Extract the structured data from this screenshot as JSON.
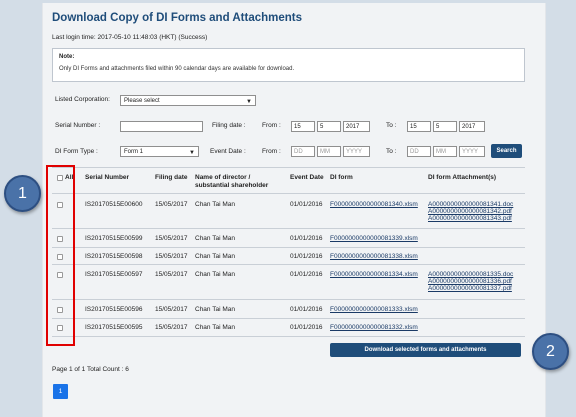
{
  "page": {
    "title": "Download Copy of DI Forms and Attachments",
    "last_login": "Last login time: 2017-05-10 11:48:03 (HKT) (Success)",
    "note_title": "Note:",
    "note_text": "Only DI Forms and attachments filed within 90 calendar days are available for download."
  },
  "filters": {
    "listed_corp_label": "Listed Corporation:",
    "listed_corp_value": "Please select",
    "serial_label": "Serial Number :",
    "serial_value": "",
    "filing_date_label": "Filing date :",
    "from_label": "From :",
    "to_label": "To :",
    "filing_from": {
      "day": "15",
      "month": "5",
      "year": "2017"
    },
    "filing_to": {
      "day": "15",
      "month": "5",
      "year": "2017"
    },
    "form_type_label": "DI Form Type :",
    "form_type_value": "Form 1",
    "event_date_label": "Event Date :",
    "event_from": {
      "day": "DD",
      "month": "MM",
      "year": "YYYY"
    },
    "event_to": {
      "day": "DD",
      "month": "MM",
      "year": "YYYY"
    },
    "search_label": "Search"
  },
  "table": {
    "headers": {
      "all": "All",
      "serial": "Serial Number",
      "filing_date": "Filing date",
      "name": "Name of director / substantial shareholder",
      "event_date": "Event Date",
      "di_form": "DI form",
      "attachments": "DI form Attachment(s)"
    },
    "rows": [
      {
        "serial": "IS20170515E00600",
        "filing": "15/05/2017",
        "name": "Chan Tai Man",
        "event": "01/01/2016",
        "form": "F0000000000000081340.xlsm",
        "attachments": [
          "A0000000000000081341.doc",
          "A0000000000000081342.pdf",
          "A0000000000000081343.pdf"
        ]
      },
      {
        "serial": "IS20170515E00599",
        "filing": "15/05/2017",
        "name": "Chan Tai Man",
        "event": "01/01/2016",
        "form": "F0000000000000081339.xlsm",
        "attachments": []
      },
      {
        "serial": "IS20170515E00598",
        "filing": "15/05/2017",
        "name": "Chan Tai Man",
        "event": "01/01/2016",
        "form": "F0000000000000081338.xlsm",
        "attachments": []
      },
      {
        "serial": "IS20170515E00597",
        "filing": "15/05/2017",
        "name": "Chan Tai Man",
        "event": "01/01/2016",
        "form": "F0000000000000081334.xlsm",
        "attachments": [
          "A0000000000000081335.doc",
          "A0000000000000081336.pdf",
          "A0000000000000081337.pdf"
        ]
      },
      {
        "serial": "IS20170515E00596",
        "filing": "15/05/2017",
        "name": "Chan Tai Man",
        "event": "01/01/2016",
        "form": "F0000000000000081333.xlsm",
        "attachments": []
      },
      {
        "serial": "IS20170515E00595",
        "filing": "15/05/2017",
        "name": "Chan Tai Man",
        "event": "01/01/2016",
        "form": "F0000000000000081332.xlsm",
        "attachments": []
      }
    ]
  },
  "download_label": "Download selected forms and attachments",
  "pagination": {
    "info": "Page 1 of 1   Total Count : 6",
    "current": "1"
  },
  "callouts": {
    "one": "1",
    "two": "2"
  },
  "colors": {
    "accent": "#1f4d7a",
    "highlight": "#e00000",
    "badge": "#4a72a8"
  }
}
